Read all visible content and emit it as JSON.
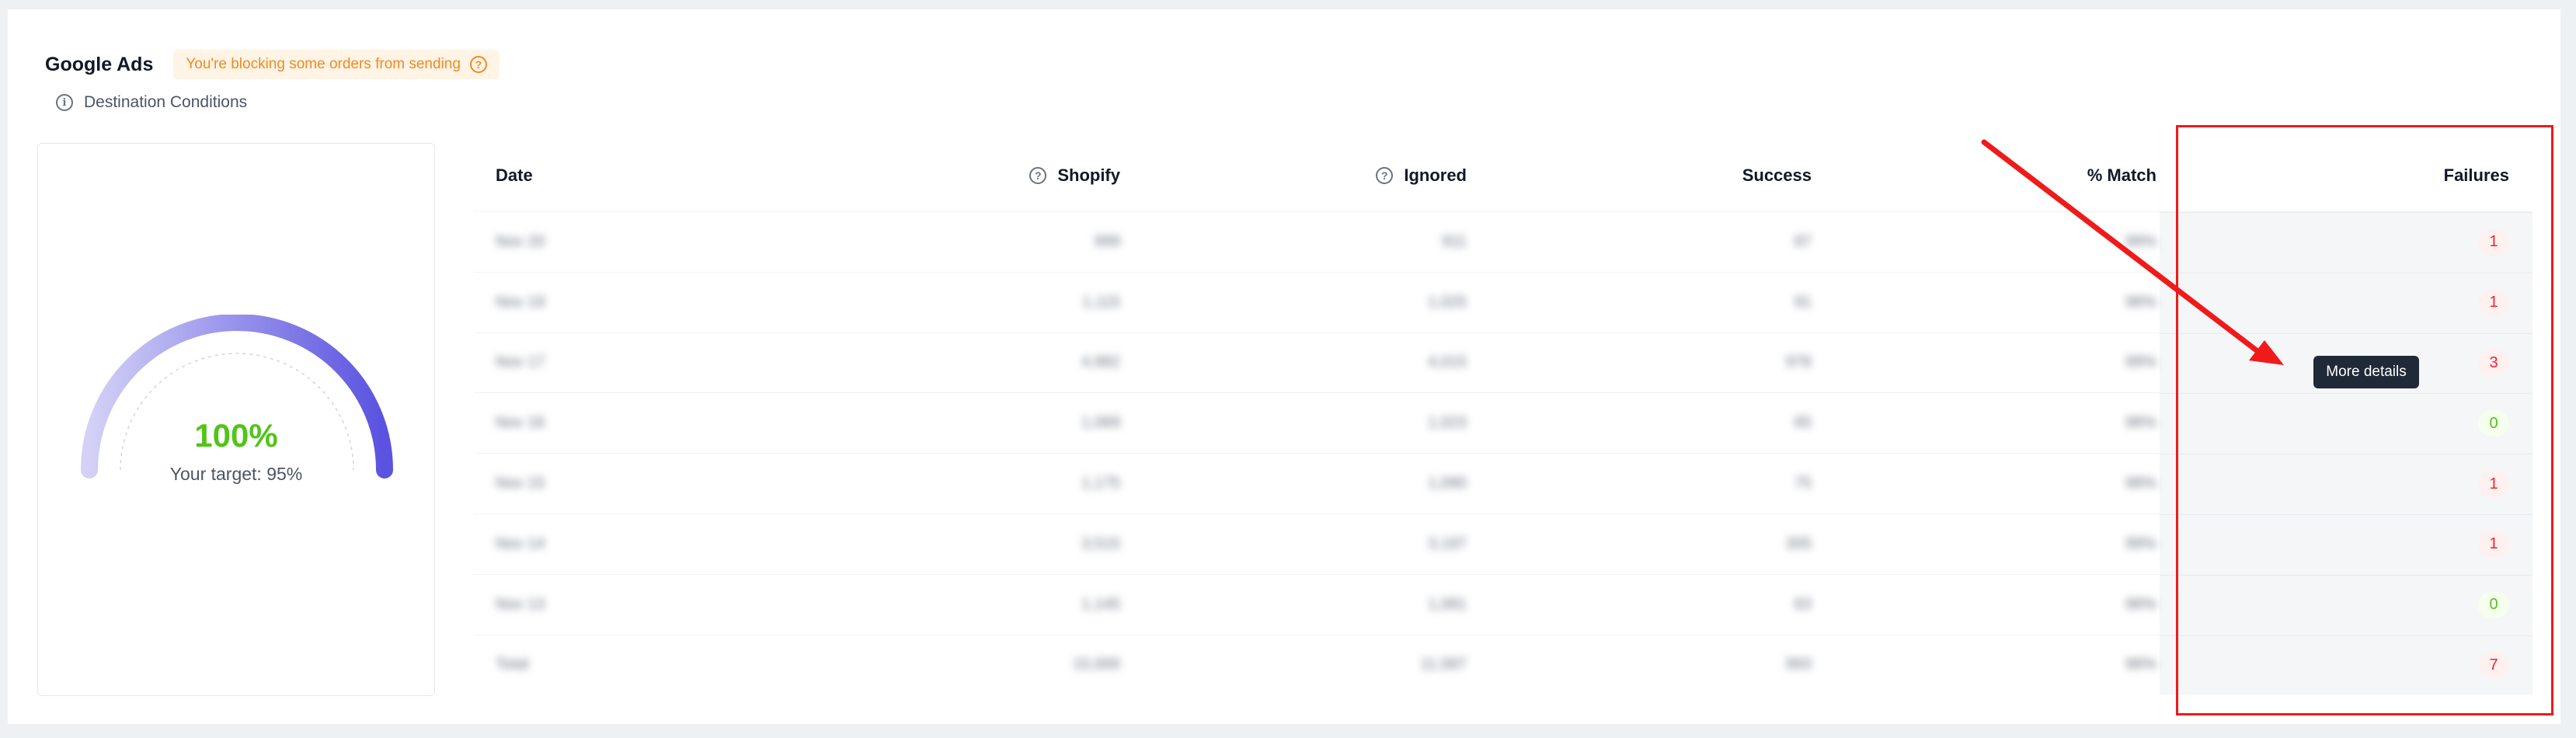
{
  "header": {
    "title": "Google Ads",
    "warning": "You're blocking some orders from sending",
    "destination_conditions": "Destination Conditions"
  },
  "gauge": {
    "value": "100%",
    "value_fraction": 1.0,
    "target": "Your target: 95%",
    "colors": {
      "start": "#c9c7f5",
      "end": "#5a52e0",
      "value": "#52c41a"
    }
  },
  "table": {
    "columns": [
      "Date",
      "Shopify",
      "Ignored",
      "Success",
      "% Match",
      "Failures"
    ],
    "rows": [
      {
        "date": "Nov 20",
        "shopify": "999",
        "ignored": "911",
        "success": "87",
        "match": "99%",
        "failures": "1"
      },
      {
        "date": "Nov 19",
        "shopify": "1,115",
        "ignored": "1,025",
        "success": "91",
        "match": "98%",
        "failures": "1"
      },
      {
        "date": "Nov 17",
        "shopify": "4,982",
        "ignored": "4,015",
        "success": "976",
        "match": "99%",
        "failures": "3"
      },
      {
        "date": "Nov 16",
        "shopify": "1,069",
        "ignored": "1,023",
        "success": "65",
        "match": "98%",
        "failures": "0"
      },
      {
        "date": "Nov 15",
        "shopify": "1,175",
        "ignored": "1,090",
        "success": "75",
        "match": "98%",
        "failures": "1"
      },
      {
        "date": "Nov 14",
        "shopify": "3,515",
        "ignored": "3,197",
        "success": "305",
        "match": "99%",
        "failures": "1"
      },
      {
        "date": "Nov 13",
        "shopify": "1,145",
        "ignored": "1,081",
        "success": "63",
        "match": "98%",
        "failures": "0"
      },
      {
        "date": "Total",
        "shopify": "15,000",
        "ignored": "11,587",
        "success": "993",
        "match": "98%",
        "failures": "7"
      }
    ]
  },
  "tooltip": {
    "text": "More details"
  },
  "annotation": {
    "color": "#ef1a1a"
  }
}
